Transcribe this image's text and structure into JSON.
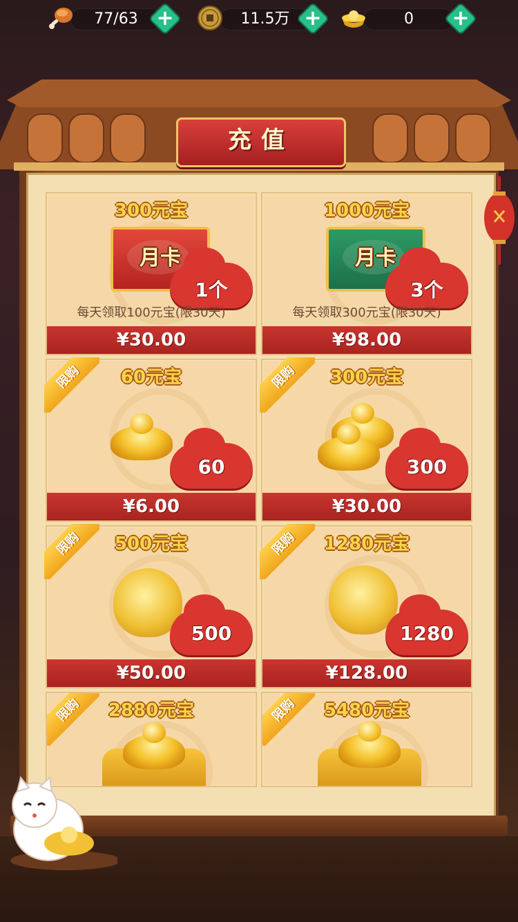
{
  "topbar": {
    "stamina": "77/63",
    "coins": "11.5万",
    "yuanbao": "0",
    "plus_label": "+"
  },
  "title": "充值",
  "colors": {
    "price_bar": "#a92420",
    "gold_text": "#fbd34b",
    "badge": "#f1a51c"
  },
  "cards": [
    {
      "title": "300元宝",
      "price": "¥30.00",
      "desc": "每天领取100元宝(限30天)",
      "card_label": "月卡",
      "count": "1个"
    },
    {
      "title": "1000元宝",
      "price": "¥98.00",
      "desc": "每天领取300元宝(限30天)",
      "card_label": "月卡",
      "count": "3个"
    },
    {
      "title": "60元宝",
      "price": "¥6.00",
      "badge": "限购",
      "count": "60"
    },
    {
      "title": "300元宝",
      "price": "¥30.00",
      "badge": "限购",
      "count": "300"
    },
    {
      "title": "500元宝",
      "price": "¥50.00",
      "badge": "限购",
      "count": "500"
    },
    {
      "title": "1280元宝",
      "price": "¥128.00",
      "badge": "限购",
      "count": "1280"
    },
    {
      "title": "2880元宝",
      "badge": "限购"
    },
    {
      "title": "5480元宝",
      "badge": "限购"
    }
  ]
}
